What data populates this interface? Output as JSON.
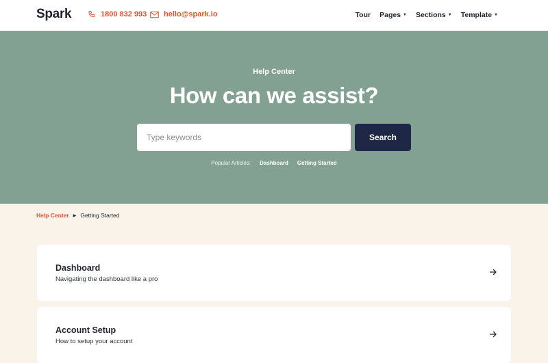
{
  "header": {
    "logo": "Spark",
    "phone": "1800 832 993",
    "email": "hello@spark.io",
    "nav": [
      {
        "label": "Tour"
      },
      {
        "label": "Pages"
      },
      {
        "label": "Sections"
      },
      {
        "label": "Template"
      }
    ]
  },
  "hero": {
    "kicker": "Help Center",
    "title": "How can we assist?",
    "search_placeholder": "Type keywords",
    "search_value": "",
    "search_button": "Search",
    "popular_label": "Popular Articles:",
    "popular_links": [
      "Dashboard",
      "Getting Started"
    ]
  },
  "breadcrumb": {
    "parent": "Help Center",
    "current": "Getting Started"
  },
  "articles": [
    {
      "title": "Dashboard",
      "description": "Navigating the dashboard like a pro"
    },
    {
      "title": "Account Setup",
      "description": "How to setup your account"
    }
  ],
  "colors": {
    "accent": "#d8572a",
    "hero_bg": "#83a193",
    "button_bg": "#1f2746",
    "page_bg": "#f9f3ea"
  },
  "icons": {
    "phone": "phone-icon",
    "email": "mail-icon",
    "dropdown": "caret-down-icon",
    "breadcrumb_sep": "caret-right-icon",
    "card_arrow": "arrow-right-icon"
  }
}
